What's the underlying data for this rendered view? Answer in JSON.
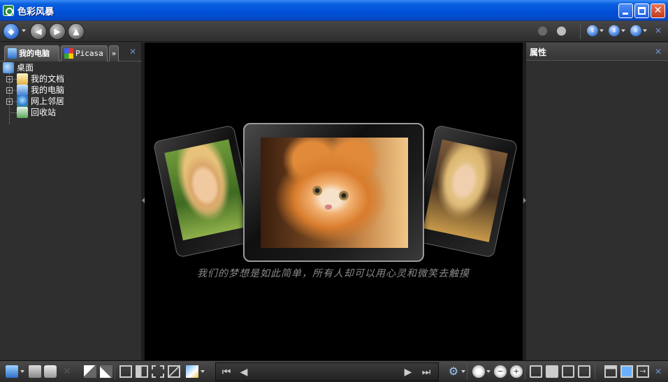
{
  "window": {
    "title": "色彩风暴"
  },
  "toolbar": {
    "nav_buttons": [
      "home",
      "back",
      "forward",
      "up"
    ]
  },
  "left_panel": {
    "tabs": [
      {
        "label": "我的电脑",
        "active": true
      },
      {
        "label": "Picasa",
        "active": false
      }
    ],
    "more_label": "»",
    "tree": [
      {
        "label": "桌面",
        "level": 0,
        "expandable": false
      },
      {
        "label": "我的文档",
        "level": 1,
        "expandable": true
      },
      {
        "label": "我的电脑",
        "level": 1,
        "expandable": true
      },
      {
        "label": "网上邻居",
        "level": 1,
        "expandable": true
      },
      {
        "label": "回收站",
        "level": 1,
        "expandable": false
      }
    ]
  },
  "viewer": {
    "caption": "我们的梦想是如此简单，所有人却可以用心灵和微笑去触摸"
  },
  "right_panel": {
    "title": "属性"
  },
  "colors": {
    "titlebar": "#0050d8",
    "panel": "#2f2f2f",
    "viewer_bg": "#000000"
  }
}
